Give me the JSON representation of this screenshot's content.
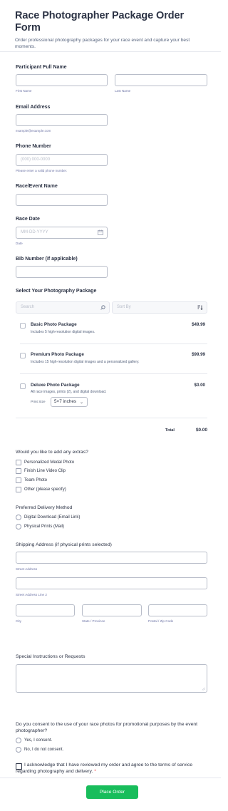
{
  "form": {
    "title": "Race Photographer Package Order Form",
    "subtitle": "Order professional photography packages for your race event and capture your best moments."
  },
  "participant": {
    "label": "Participant Full Name",
    "first_sub": "First Name",
    "last_sub": "Last Name"
  },
  "email": {
    "label": "Email Address",
    "sub": "example@example.com"
  },
  "phone": {
    "label": "Phone Number",
    "placeholder": "(000) 000-0000",
    "sub": "Please enter a valid phone number."
  },
  "race_event": {
    "label": "Race/Event Name"
  },
  "race_date": {
    "label": "Race Date",
    "placeholder": "MM-DD-YYYY",
    "sub": "Date"
  },
  "bib": {
    "label": "Bib Number (if applicable)"
  },
  "packages": {
    "label": "Select Your Photography Package",
    "search_placeholder": "Search",
    "sort_placeholder": "Sort By",
    "items": [
      {
        "title": "Basic Photo Package",
        "desc": "Includes 5 high-resolution digital images.",
        "price": "$49.99"
      },
      {
        "title": "Premium Photo Package",
        "desc": "Includes 15 high-resolution digital images and a personalized gallery.",
        "price": "$99.99"
      },
      {
        "title": "Deluxe Photo Package",
        "desc": "All race images, prints (2), and digital download.",
        "price": "$0.00"
      }
    ],
    "print_size_label": "Print Size",
    "print_size_value": "5×7 inches",
    "total_label": "Total",
    "total_value": "$0.00"
  },
  "extras": {
    "label": "Would you like to add any extras?",
    "options": [
      "Personalized Medal Photo",
      "Finish Line Video Clip",
      "Team Photo",
      "Other (please specify)"
    ]
  },
  "delivery": {
    "label": "Preferred Delivery Method",
    "options": [
      "Digital Download (Email Link)",
      "Physical Prints (Mail)"
    ]
  },
  "shipping": {
    "label": "Shipping Address (if physical prints selected)",
    "street": "Street Address",
    "street2": "Street Address Line 2",
    "city": "City",
    "state": "State / Province",
    "postal": "Postal / Zip Code"
  },
  "instructions": {
    "label": "Special Instructions or Requests"
  },
  "consent": {
    "label": "Do you consent to the use of your race photos for promotional purposes by the event photographer?",
    "options": [
      "Yes, I consent.",
      "No, I do not consent."
    ]
  },
  "terms": {
    "text": "I acknowledge that I have reviewed my order and agree to the terms of service regarding photography and delivery.",
    "required_mark": "*"
  },
  "submit_label": "Place Order",
  "colors": {
    "accent": "#18bd5b",
    "text": "#2c3345",
    "border": "#b8bdc9",
    "required": "#f23a3c"
  }
}
